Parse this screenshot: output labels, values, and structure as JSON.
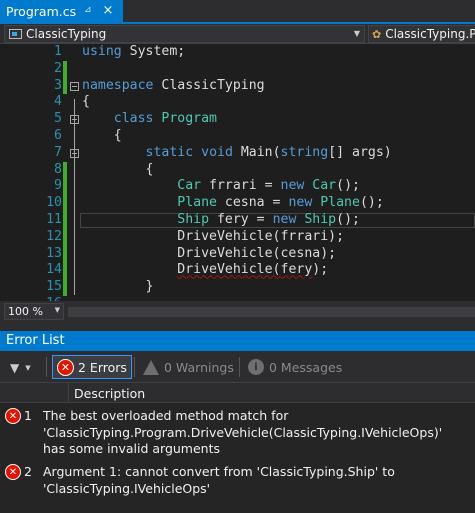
{
  "tab": {
    "title": "Program.cs",
    "pin_glyph": "⊿",
    "close_glyph": "×"
  },
  "nav": {
    "left_dropdown": "ClassicTyping",
    "right_dropdown": "ClassicTyping.Pr"
  },
  "editor": {
    "lines": [
      {
        "n": "1",
        "changed": false
      },
      {
        "n": "2",
        "changed": true
      },
      {
        "n": "3",
        "changed": true
      },
      {
        "n": "4",
        "changed": false
      },
      {
        "n": "5",
        "changed": false
      },
      {
        "n": "6",
        "changed": false
      },
      {
        "n": "7",
        "changed": false
      },
      {
        "n": "8",
        "changed": true
      },
      {
        "n": "9",
        "changed": true
      },
      {
        "n": "10",
        "changed": true
      },
      {
        "n": "11",
        "changed": true
      },
      {
        "n": "12",
        "changed": true
      },
      {
        "n": "13",
        "changed": true
      },
      {
        "n": "14",
        "changed": true
      },
      {
        "n": "15",
        "changed": true
      },
      {
        "n": "16",
        "changed": false
      }
    ],
    "code": {
      "l1_kw": "using",
      "l1_rest": " System;",
      "l3_kw": "namespace",
      "l3_rest": " ClassicTyping",
      "l4": "{",
      "l5_kw": "class",
      "l5_ty": "Program",
      "l6": "{",
      "l7_kw1": "static",
      "l7_kw2": "void",
      "l7_name": "Main(",
      "l7_kw3": "string",
      "l7_rest": "[] args)",
      "l8": "{",
      "l9_ty1": "Car",
      "l9_mid": " frrari = ",
      "l9_kw": "new",
      "l9_ty2": "Car",
      "l9_end": "();",
      "l10_ty1": "Plane",
      "l10_mid": " cesna = ",
      "l10_kw": "new",
      "l10_ty2": "Plane",
      "l10_end": "();",
      "l11_ty1": "Ship",
      "l11_mid": " fery = ",
      "l11_kw": "new",
      "l11_ty2": "Ship",
      "l11_end": "();",
      "l12": "DriveVehicle(frrari);",
      "l13": "DriveVehicle(cesna);",
      "l14_a": "DriveVehicle(",
      "l14_sq": "fery",
      "l14_b": ");",
      "l15": "}"
    }
  },
  "zoom": {
    "value": "100 %"
  },
  "error_list": {
    "title": "Error List",
    "errors_btn": "2 Errors",
    "warnings_btn": "0 Warnings",
    "messages_btn": "0 Messages",
    "column_description": "Description",
    "rows": [
      {
        "num": "1",
        "message": "The best overloaded method match for 'ClassicTyping.Program.DriveVehicle(ClassicTyping.IVehicleOps)' has some invalid arguments"
      },
      {
        "num": "2",
        "message": "Argument 1: cannot convert from 'ClassicTyping.Ship' to 'ClassicTyping.IVehicleOps'"
      }
    ]
  },
  "colors": {
    "accent": "#007acc",
    "change_bar": "#3fae2c",
    "error": "#e51400"
  }
}
